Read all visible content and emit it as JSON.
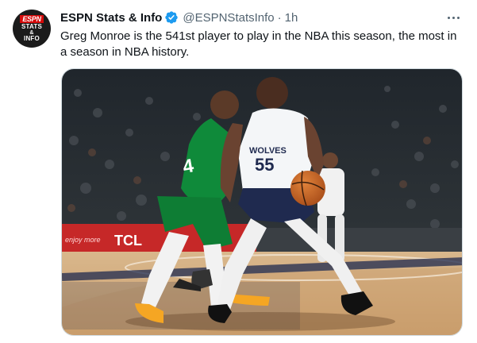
{
  "tweet": {
    "author_name": "ESPN Stats & Info",
    "author_handle": "@ESPNStatsInfo",
    "separator": "·",
    "time": "1h",
    "text": "Greg Monroe is the 541st player to play in the NBA this season, the most in a season in NBA history.",
    "avatar": {
      "brand": "ESPN",
      "line1": "STATS",
      "line2": "&",
      "line3": "INFO"
    },
    "media": {
      "jersey_team": "WOLVES",
      "jersey_number": "55",
      "green_number": "4",
      "sponsor": "TCL",
      "ad_text": "enjoy more"
    }
  },
  "colors": {
    "verified": "#1d9bf0",
    "court": "#d8b58a",
    "ad_board": "#c62828",
    "wolves_navy": "#1f2a4f"
  }
}
